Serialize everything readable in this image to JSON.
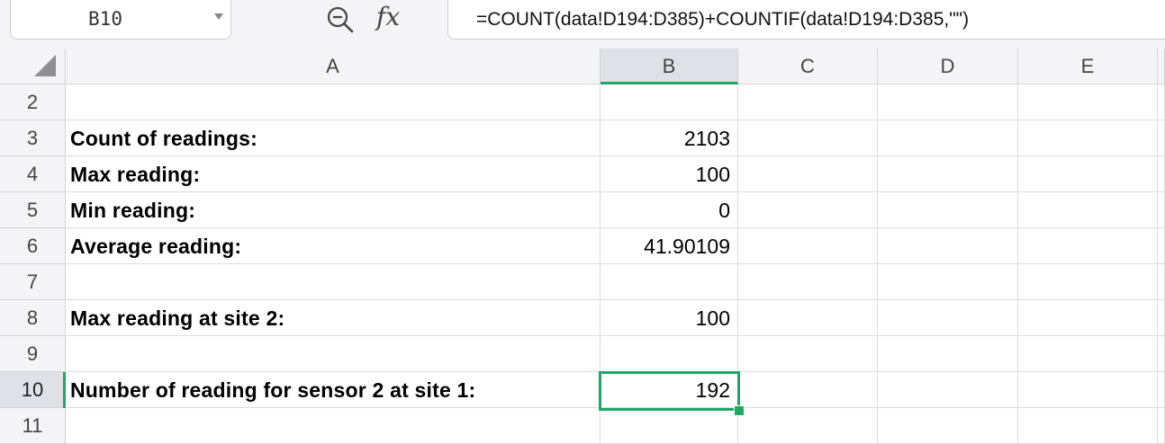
{
  "formula_bar": {
    "name_box": "B10",
    "zoom_icon": "magnifier-minus-icon",
    "fx_label": "fx",
    "formula": "=COUNT(data!D194:D385)+COUNTIF(data!D194:D385,\"\")"
  },
  "sheet": {
    "columns": [
      "A",
      "B",
      "C",
      "D",
      "E"
    ],
    "selected_column": "B",
    "selected_row": "10",
    "selection_color": "#1fa865",
    "rows": [
      {
        "num": "2",
        "label": "",
        "value": ""
      },
      {
        "num": "3",
        "label": "Count of readings:",
        "value": "2103"
      },
      {
        "num": "4",
        "label": "Max reading:",
        "value": "100"
      },
      {
        "num": "5",
        "label": "Min reading:",
        "value": "0"
      },
      {
        "num": "6",
        "label": "Average reading:",
        "value": "41.90109"
      },
      {
        "num": "7",
        "label": "",
        "value": ""
      },
      {
        "num": "8",
        "label": "Max reading at site 2:",
        "value": "100"
      },
      {
        "num": "9",
        "label": "",
        "value": ""
      },
      {
        "num": "10",
        "label": "Number of reading for sensor 2 at site 1:",
        "value": "192"
      },
      {
        "num": "11",
        "label": "",
        "value": ""
      }
    ]
  }
}
